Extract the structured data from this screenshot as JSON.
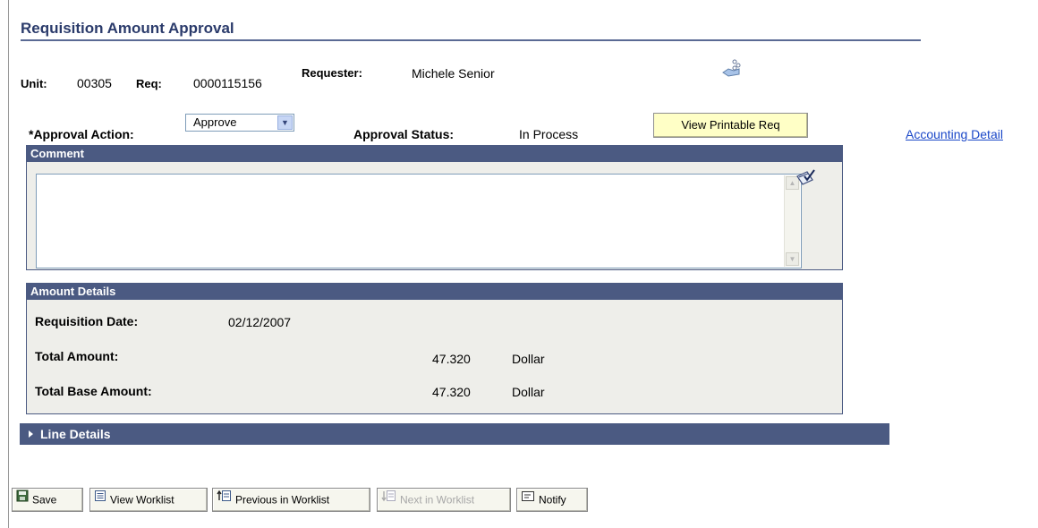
{
  "page": {
    "title": "Requisition Amount Approval"
  },
  "header": {
    "unit_label": "Unit:",
    "unit_value": "00305",
    "req_label": "Req:",
    "req_value": "0000115156",
    "requester_label": "Requester:",
    "requester_value": "Michele Senior"
  },
  "approval": {
    "action_label": "*Approval Action:",
    "action_value": "Approve",
    "status_label": "Approval Status:",
    "status_value": "In Process",
    "view_printable_label": "View Printable Req",
    "accounting_link": "Accounting Detail"
  },
  "comment": {
    "header": "Comment",
    "value": ""
  },
  "amount_details": {
    "header": "Amount Details",
    "requisition_date_label": "Requisition Date:",
    "requisition_date_value": "02/12/2007",
    "total_amount_label": "Total Amount:",
    "total_amount_value": "47.320",
    "total_amount_currency": "Dollar",
    "total_base_label": "Total Base Amount:",
    "total_base_value": "47.320",
    "total_base_currency": "Dollar"
  },
  "line_details": {
    "label": "Line Details"
  },
  "toolbar": {
    "save": "Save",
    "view_worklist": "View Worklist",
    "previous": "Previous in Worklist",
    "next": "Next in Worklist",
    "notify": "Notify"
  },
  "colors": {
    "header_bar": "#4b5a82",
    "title": "#2b3b6b",
    "button_yellow": "#ffffc6",
    "link": "#1a47c8"
  }
}
